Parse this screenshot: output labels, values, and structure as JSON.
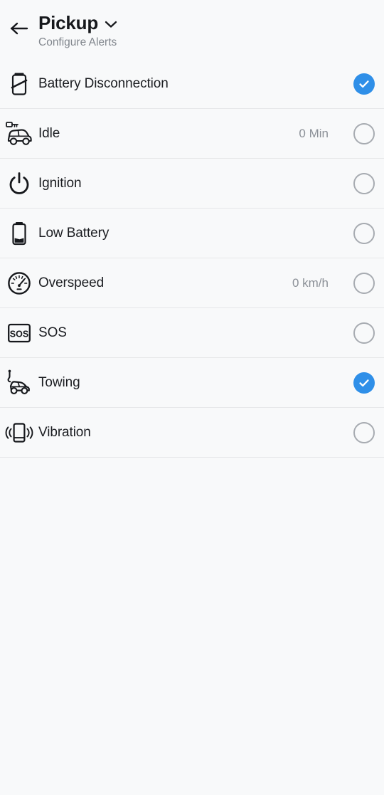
{
  "header": {
    "back_icon": "arrow-left-icon",
    "title": "Pickup",
    "dropdown_icon": "chevron-down-icon",
    "subtitle": "Configure Alerts"
  },
  "colors": {
    "accent_checked": "#2f8fe8",
    "checkbox_unchecked_border": "#a7abb1",
    "background": "#f8f9fa",
    "divider": "#e6e7e9",
    "label_text": "#1b1d21",
    "value_text": "#8b9097",
    "subtitle_text": "#81868d"
  },
  "alerts": [
    {
      "icon": "battery-disconnection-icon",
      "label": "Battery Disconnection",
      "value": "",
      "checked": true
    },
    {
      "icon": "idle-car-key-icon",
      "label": "Idle",
      "value": "0 Min",
      "checked": false
    },
    {
      "icon": "ignition-power-icon",
      "label": "Ignition",
      "value": "",
      "checked": false
    },
    {
      "icon": "low-battery-icon",
      "label": "Low Battery",
      "value": "",
      "checked": false
    },
    {
      "icon": "overspeed-speedometer-icon",
      "label": "Overspeed",
      "value": "0 km/h",
      "checked": false
    },
    {
      "icon": "sos-icon",
      "label": "SOS",
      "value": "",
      "checked": false
    },
    {
      "icon": "towing-icon",
      "label": "Towing",
      "value": "",
      "checked": true
    },
    {
      "icon": "vibration-icon",
      "label": "Vibration",
      "value": "",
      "checked": false
    }
  ]
}
